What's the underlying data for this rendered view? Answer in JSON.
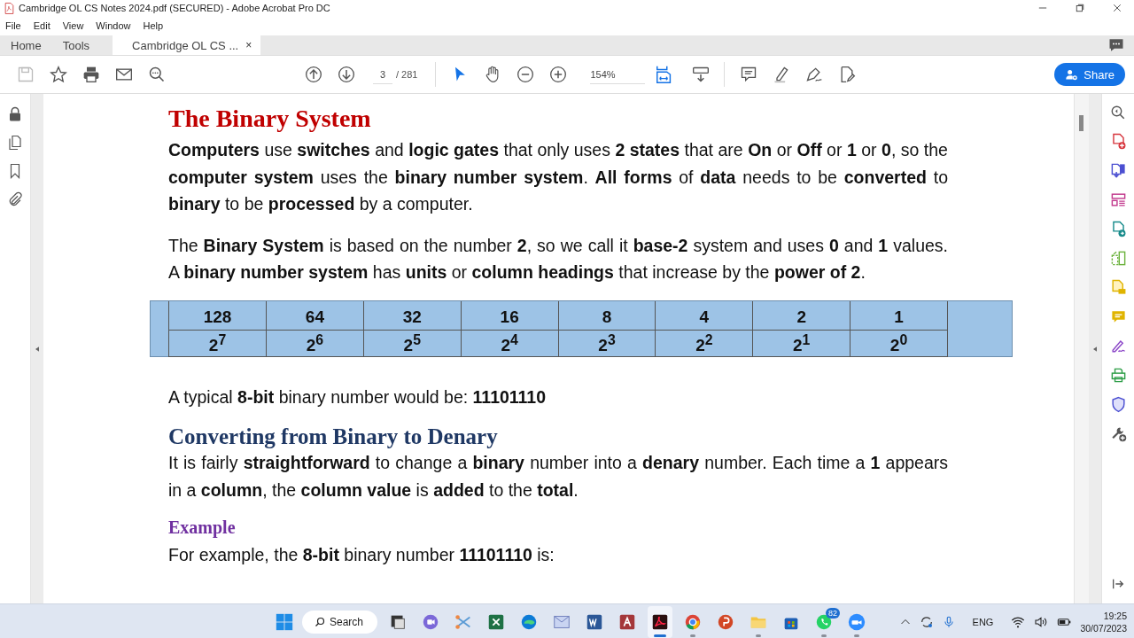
{
  "window": {
    "title": "Cambridge OL CS Notes 2024.pdf (SECURED) - Adobe Acrobat Pro DC"
  },
  "menu": [
    "File",
    "Edit",
    "View",
    "Window",
    "Help"
  ],
  "tabs": [
    {
      "label": "Home",
      "selected": false
    },
    {
      "label": "Tools",
      "selected": false
    },
    {
      "label": "Cambridge OL CS ...",
      "selected": true,
      "close": "×"
    }
  ],
  "toolbar": {
    "page": "3",
    "page_count": "/ 281",
    "zoom": "154%",
    "share": "Share"
  },
  "document": {
    "blocks": [
      {
        "kind": "title",
        "text": "The Binary System"
      },
      {
        "kind": "para",
        "text": "**Computers** use **switches** and **logic gates** that only uses **2 states** that are **On** or **Off** or **1** or **0**, so the **computer system** uses the **binary number system**. **All forms** of **data** needs to be **converted** to **binary** to be **processed** by a computer."
      },
      {
        "kind": "para",
        "text": "The **Binary System** is based on the number **2**, so we call it **base-2** system and uses **0** and **1** values. A **binary number system** has **units** or **column headings** that increase by the **power of 2**."
      },
      {
        "kind": "table",
        "rows": [
          [
            "128",
            "64",
            "32",
            "16",
            "8",
            "4",
            "2",
            "1"
          ],
          [
            "2$^{7}$",
            "2$^{6}$",
            "2$^{5}$",
            "2$^{4}$",
            "2$^{3}$",
            "2$^{2}$",
            "2$^{1}$",
            "2$^{0}$"
          ]
        ]
      },
      {
        "kind": "line",
        "text": "A typical **8-bit** binary number would be: **11101110**"
      },
      {
        "kind": "heading",
        "text": "Converting from Binary to Denary"
      },
      {
        "kind": "para",
        "text": "It is fairly **straightforward** to change a **binary** number into a **denary** number. Each time a **1** appears in a **column**, the **column value** is **added** to the **total**."
      },
      {
        "kind": "subheading",
        "text": "Example"
      },
      {
        "kind": "line",
        "text": "For example, the **8-bit** binary number **11101110** is:"
      }
    ]
  },
  "taskbar": {
    "search": "Search",
    "apps": [
      {
        "kind": "desktop",
        "running": false,
        "selected": false
      },
      {
        "kind": "chat",
        "running": false,
        "selected": false
      },
      {
        "kind": "snip",
        "running": false,
        "selected": false
      },
      {
        "kind": "excel",
        "running": false,
        "selected": false
      },
      {
        "kind": "edge",
        "running": false,
        "selected": false
      },
      {
        "kind": "mail",
        "running": false,
        "selected": false
      },
      {
        "kind": "word",
        "running": false,
        "selected": false
      },
      {
        "kind": "access",
        "running": false,
        "selected": false
      },
      {
        "kind": "acrobat",
        "running": true,
        "selected": true
      },
      {
        "kind": "chrome",
        "running": true,
        "selected": false
      },
      {
        "kind": "powerpoint",
        "running": false,
        "selected": false
      },
      {
        "kind": "folder",
        "running": true,
        "selected": false
      },
      {
        "kind": "store",
        "running": false,
        "selected": false
      },
      {
        "kind": "whatsapp",
        "running": true,
        "selected": false,
        "badge": "82"
      },
      {
        "kind": "zoom",
        "running": true,
        "selected": false
      }
    ],
    "language": "ENG",
    "time": "19:25",
    "date": "30/07/2023"
  }
}
